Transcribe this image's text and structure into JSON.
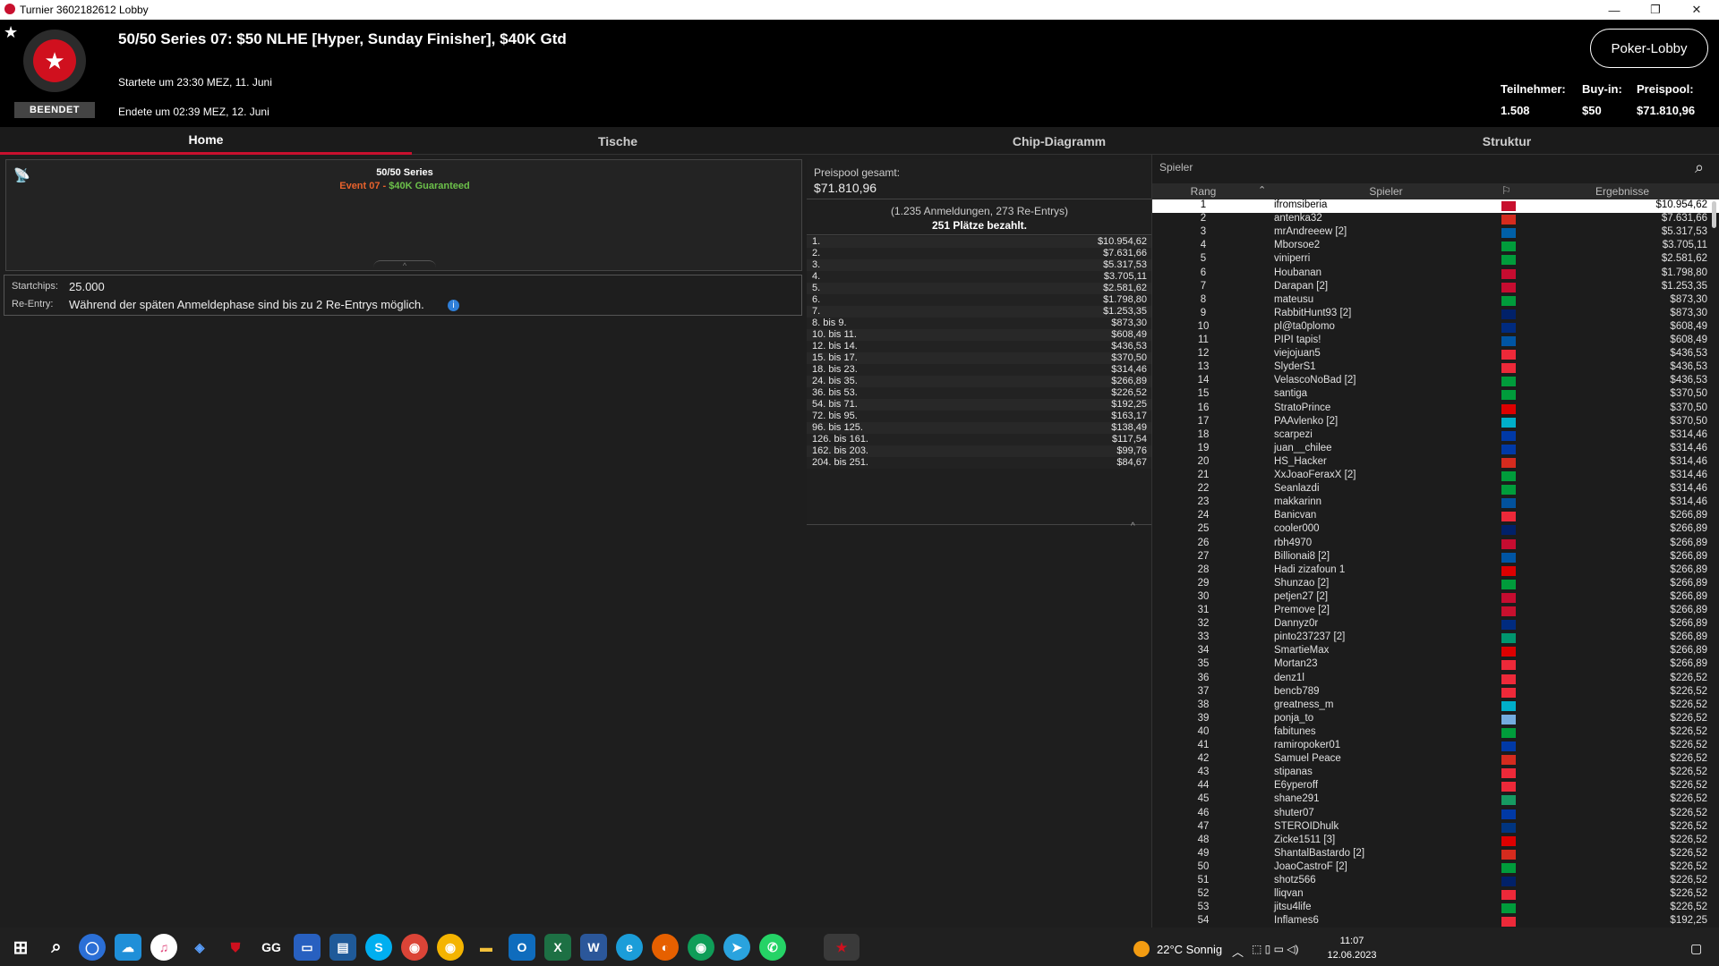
{
  "window": {
    "title": "Turnier 3602182612 Lobby"
  },
  "header": {
    "name": "50/50 Series 07: $50 NLHE [Hyper, Sunday Finisher], $40K Gtd",
    "started": "Startete um 23:30 MEZ, 11. Juni",
    "ended": "Endete um 02:39 MEZ, 12. Juni",
    "status": "BEENDET",
    "lobby_button": "Poker-Lobby",
    "stats": [
      {
        "label": "Teilnehmer:",
        "value": "1.508"
      },
      {
        "label": "Buy-in:",
        "value": "$50"
      },
      {
        "label": "Preispool:",
        "value": "$71.810,96"
      }
    ]
  },
  "tabs": [
    "Home",
    "Tische",
    "Chip-Diagramm",
    "Struktur"
  ],
  "home": {
    "series": "50/50 Series",
    "event_prefix": "Event 07",
    "event_sep": " - ",
    "event_gtd": "$40K Guaranteed",
    "startchips_label": "Startchips:",
    "startchips_value": "25.000",
    "reentry_label": "Re-Entry:",
    "reentry_value": "Während der späten Anmeldephase sind bis zu 2 Re-Entrys möglich."
  },
  "prizepool": {
    "label": "Preispool gesamt:",
    "value": "$71.810,96",
    "entries": "(1.235 Anmeldungen, 273 Re-Entrys)",
    "paid": "251 Plätze bezahlt.",
    "rows": [
      [
        "1.",
        "$10.954,62"
      ],
      [
        "2.",
        "$7.631,66"
      ],
      [
        "3.",
        "$5.317,53"
      ],
      [
        "4.",
        "$3.705,11"
      ],
      [
        "5.",
        "$2.581,62"
      ],
      [
        "6.",
        "$1.798,80"
      ],
      [
        "7.",
        "$1.253,35"
      ],
      [
        "8. bis 9.",
        "$873,30"
      ],
      [
        "10. bis 11.",
        "$608,49"
      ],
      [
        "12. bis 14.",
        "$436,53"
      ],
      [
        "15. bis 17.",
        "$370,50"
      ],
      [
        "18. bis 23.",
        "$314,46"
      ],
      [
        "24. bis 35.",
        "$266,89"
      ],
      [
        "36. bis 53.",
        "$226,52"
      ],
      [
        "54. bis 71.",
        "$192,25"
      ],
      [
        "72. bis 95.",
        "$163,17"
      ],
      [
        "96. bis 125.",
        "$138,49"
      ],
      [
        "126. bis 161.",
        "$117,54"
      ],
      [
        "162. bis 203.",
        "$99,76"
      ],
      [
        "204. bis 251.",
        "$84,67"
      ]
    ]
  },
  "players": {
    "search_placeholder": "Spieler",
    "col_rank": "Rang",
    "col_player": "Spieler",
    "col_result": "Ergebnisse",
    "rows": [
      [
        "1",
        "ifromsiberia",
        "#c8102e",
        "$10.954,62"
      ],
      [
        "2",
        "antenka32",
        "#d52b1e",
        "$7.631,66"
      ],
      [
        "3",
        "mrAndreeew [2]",
        "#0060a8",
        "$5.317,53"
      ],
      [
        "4",
        "Mborsoe2",
        "#009c3b",
        "$3.705,11"
      ],
      [
        "5",
        "viniperri",
        "#009c3b",
        "$2.581,62"
      ],
      [
        "6",
        "Houbanan",
        "#c60c30",
        "$1.798,80"
      ],
      [
        "7",
        "Darapan [2]",
        "#c60c30",
        "$1.253,35"
      ],
      [
        "8",
        "mateusu",
        "#009c3b",
        "$873,30"
      ],
      [
        "9",
        "RabbitHunt93 [2]",
        "#012169",
        "$873,30"
      ],
      [
        "10",
        "pl@ta0plomo",
        "#002b7f",
        "$608,49"
      ],
      [
        "11",
        "PIPI tapis!",
        "#0055a4",
        "$608,49"
      ],
      [
        "12",
        "viejojuan5",
        "#ed2939",
        "$436,53"
      ],
      [
        "13",
        "SlyderS1",
        "#ed2939",
        "$436,53"
      ],
      [
        "14",
        "VelascoNoBad [2]",
        "#009c3b",
        "$436,53"
      ],
      [
        "15",
        "santiga",
        "#009c3b",
        "$370,50"
      ],
      [
        "16",
        "StratoPrince",
        "#dd0000",
        "$370,50"
      ],
      [
        "17",
        "PAAvlenko [2]",
        "#00afca",
        "$370,50"
      ],
      [
        "18",
        "scarpezi",
        "#0039a6",
        "$314,46"
      ],
      [
        "19",
        "juan__chilee",
        "#0039a6",
        "$314,46"
      ],
      [
        "20",
        "HS_Hacker",
        "#d52b1e",
        "$314,46"
      ],
      [
        "21",
        "XxJoaoFeraxX [2]",
        "#009c3b",
        "$314,46"
      ],
      [
        "22",
        "Seanlazdi",
        "#009c3b",
        "$314,46"
      ],
      [
        "23",
        "makkarinn",
        "#02529c",
        "$314,46"
      ],
      [
        "24",
        "Banicvan",
        "#ed2939",
        "$266,89"
      ],
      [
        "25",
        "cooler000",
        "#012169",
        "$266,89"
      ],
      [
        "26",
        "rbh4970",
        "#c60c30",
        "$266,89"
      ],
      [
        "27",
        "Billionai8 [2]",
        "#0055a4",
        "$266,89"
      ],
      [
        "28",
        "Hadi zizafoun 1",
        "#dd0000",
        "$266,89"
      ],
      [
        "29",
        "Shunzao [2]",
        "#009c3b",
        "$266,89"
      ],
      [
        "30",
        "petjen27 [2]",
        "#c60c30",
        "$266,89"
      ],
      [
        "31",
        "Premove [2]",
        "#c8102e",
        "$266,89"
      ],
      [
        "32",
        "Dannyz0r",
        "#002b7f",
        "$266,89"
      ],
      [
        "33",
        "pinto237237 [2]",
        "#00966e",
        "$266,89"
      ],
      [
        "34",
        "SmartieMax",
        "#dd0000",
        "$266,89"
      ],
      [
        "35",
        "Mortan23",
        "#ed2939",
        "$266,89"
      ],
      [
        "36",
        "denz1l",
        "#ed2939",
        "$226,52"
      ],
      [
        "37",
        "bencb789",
        "#ed2939",
        "$226,52"
      ],
      [
        "38",
        "greatness_m",
        "#00afca",
        "$226,52"
      ],
      [
        "39",
        "ponja_to",
        "#74acdf",
        "$226,52"
      ],
      [
        "40",
        "fabitunes",
        "#009c3b",
        "$226,52"
      ],
      [
        "41",
        "ramiropoker01",
        "#0039a6",
        "$226,52"
      ],
      [
        "42",
        "Samuel Peace",
        "#d52b1e",
        "$226,52"
      ],
      [
        "43",
        "stipanas",
        "#ed2939",
        "$226,52"
      ],
      [
        "44",
        "E6yperoff",
        "#ed2939",
        "$226,52"
      ],
      [
        "45",
        "shane291",
        "#169b62",
        "$226,52"
      ],
      [
        "46",
        "shuter07",
        "#0039a6",
        "$226,52"
      ],
      [
        "47",
        "STEROIDhulk",
        "#003580",
        "$226,52"
      ],
      [
        "48",
        "Zicke1511 [3]",
        "#dd0000",
        "$226,52"
      ],
      [
        "49",
        "ShantalBastardo [2]",
        "#d52b1e",
        "$226,52"
      ],
      [
        "50",
        "JoaoCastroF [2]",
        "#009c3b",
        "$226,52"
      ],
      [
        "51",
        "shotz566",
        "#012169",
        "$226,52"
      ],
      [
        "52",
        "lliqvan",
        "#ed2939",
        "$226,52"
      ],
      [
        "53",
        "jitsu4life",
        "#009c3b",
        "$226,52"
      ],
      [
        "54",
        "Inflames6",
        "#ed2939",
        "$192,25"
      ]
    ]
  },
  "taskbar": {
    "weather": "22°C  Sonnig",
    "time": "11:07",
    "date": "12.06.2023"
  }
}
